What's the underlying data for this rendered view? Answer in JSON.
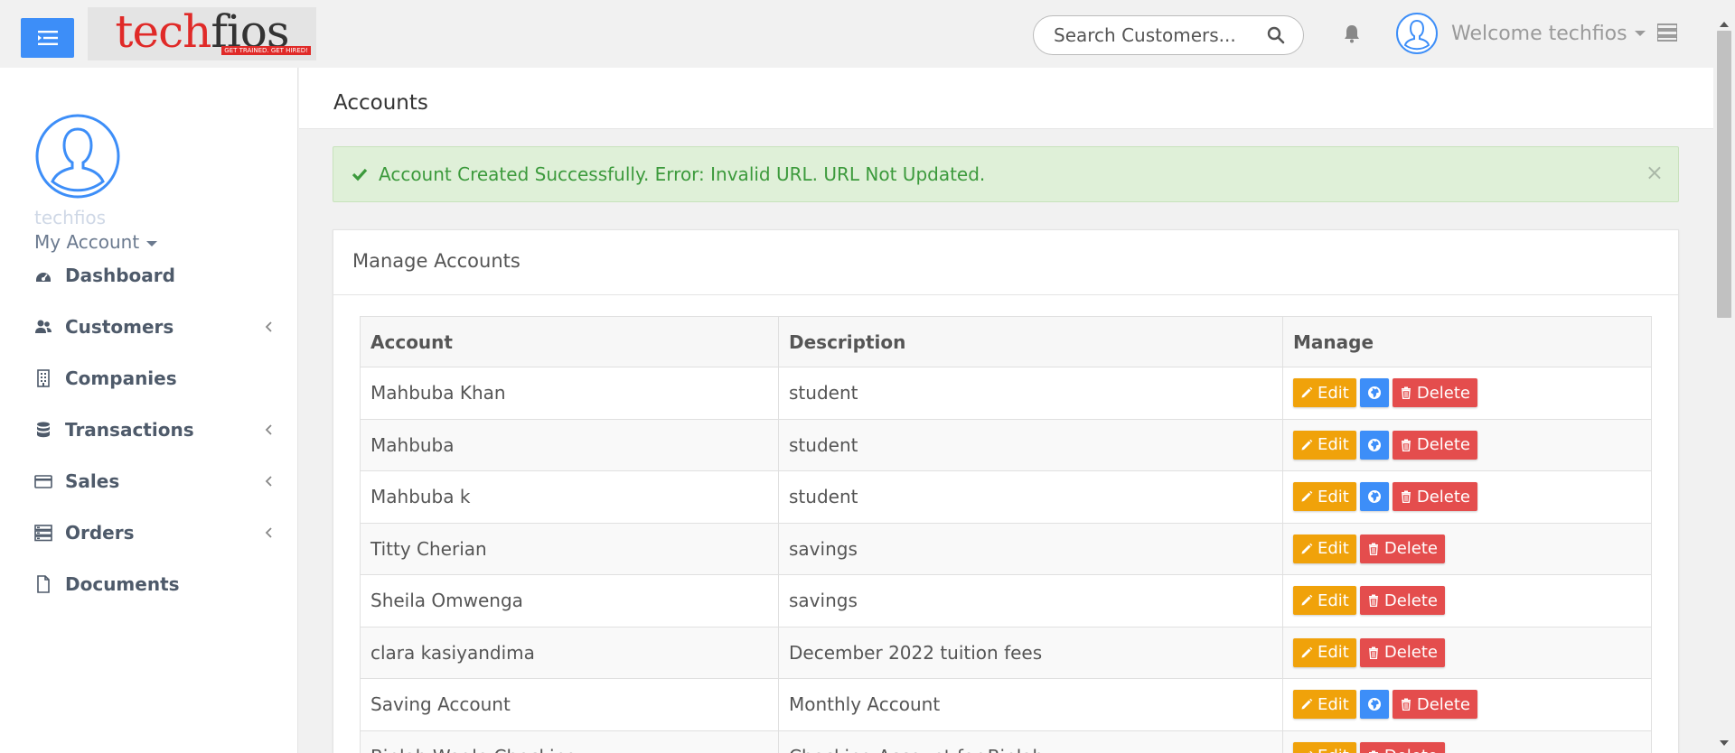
{
  "header": {
    "logo_text_left": "tech",
    "logo_text_right": "fios",
    "logo_tagline": "GET TRAINED. GET HIRED!",
    "search_placeholder": "Search Customers...",
    "welcome": "Welcome techfios"
  },
  "sidebar": {
    "profile_name": "techfios",
    "my_account": "My Account",
    "items": [
      {
        "label": "Dashboard",
        "icon": "dashboard-icon",
        "has_children": false
      },
      {
        "label": "Customers",
        "icon": "users-icon",
        "has_children": true
      },
      {
        "label": "Companies",
        "icon": "building-icon",
        "has_children": false
      },
      {
        "label": "Transactions",
        "icon": "database-icon",
        "has_children": true
      },
      {
        "label": "Sales",
        "icon": "credit-card-icon",
        "has_children": true
      },
      {
        "label": "Orders",
        "icon": "server-icon",
        "has_children": true
      },
      {
        "label": "Documents",
        "icon": "file-icon",
        "has_children": false
      }
    ]
  },
  "page": {
    "title": "Accounts",
    "alert": "Account Created Successfully. Error: Invalid URL. URL Not Updated.",
    "alert_close": "×",
    "panel_title": "Manage Accounts"
  },
  "table": {
    "headers": [
      "Account",
      "Description",
      "Manage"
    ],
    "edit_label": "Edit",
    "delete_label": "Delete",
    "rows": [
      {
        "account": "Mahbuba Khan",
        "description": "student",
        "has_link": true
      },
      {
        "account": "Mahbuba",
        "description": "student",
        "has_link": true
      },
      {
        "account": "Mahbuba k",
        "description": "student",
        "has_link": true
      },
      {
        "account": "Titty Cherian",
        "description": "savings",
        "has_link": false
      },
      {
        "account": "Sheila Omwenga",
        "description": "savings",
        "has_link": false
      },
      {
        "account": "clara kasiyandima",
        "description": "December 2022 tuition fees",
        "has_link": false
      },
      {
        "account": "Saving Account",
        "description": "Monthly Account",
        "has_link": true
      },
      {
        "account": "Biplab Wagle Checking",
        "description": "Checking Account for Biplab",
        "has_link": false
      }
    ]
  },
  "colors": {
    "primary": "#3d8ef8",
    "edit": "#f0a20a",
    "delete": "#e44d4d",
    "success_bg": "#dff0d8",
    "success_text": "#3c9a3c"
  }
}
